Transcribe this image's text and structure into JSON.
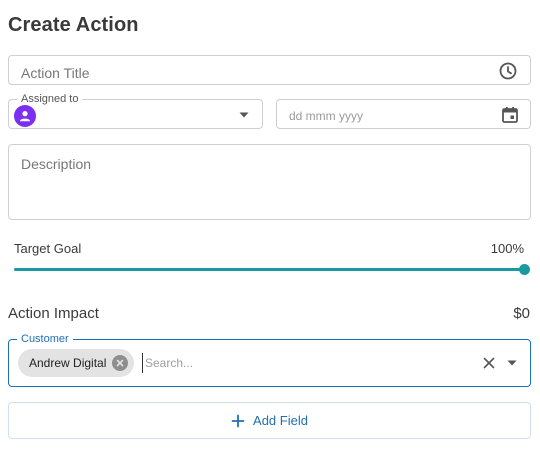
{
  "page": {
    "title": "Create Action"
  },
  "action_title": {
    "placeholder": "Action Title",
    "icon": "clock-icon"
  },
  "assigned_to": {
    "label": "Assigned to",
    "avatar_icon": "person-icon",
    "dropdown_icon": "caret-down-icon"
  },
  "due_date": {
    "placeholder": "dd mmm yyyy",
    "icon": "calendar-icon"
  },
  "description": {
    "placeholder": "Description"
  },
  "target_goal": {
    "label": "Target Goal",
    "value_text": "100%",
    "value": 100,
    "accent": "#1a9aa0"
  },
  "action_impact": {
    "label": "Action Impact",
    "value": "$0"
  },
  "customer": {
    "label": "Customer",
    "selected_chip": "Andrew Digital",
    "search_placeholder": "Search...",
    "clear_icon": "close-icon",
    "dropdown_icon": "caret-down-icon",
    "accent": "#1e6fb5"
  },
  "add_field": {
    "label": "Add Field",
    "icon": "plus-icon"
  },
  "colors": {
    "avatar": "#7b2ff2",
    "link_blue": "#1e6fb5"
  }
}
